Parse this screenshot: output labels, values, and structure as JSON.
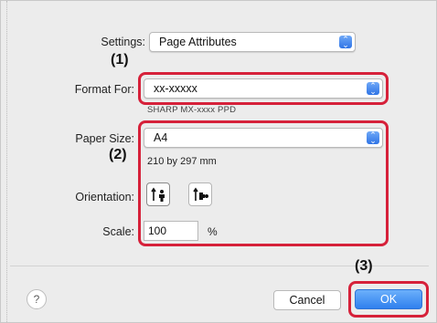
{
  "settings": {
    "label": "Settings:",
    "value": "Page Attributes"
  },
  "format_for": {
    "label": "Format For:",
    "value": "xx-xxxxx",
    "hint": "SHARP MX-xxxx PPD"
  },
  "paper_size": {
    "label": "Paper Size:",
    "value": "A4",
    "dimensions": "210 by 297 mm"
  },
  "orientation": {
    "label": "Orientation:"
  },
  "scale": {
    "label": "Scale:",
    "value": "100",
    "unit": "%"
  },
  "callouts": {
    "c1": "(1)",
    "c2": "(2)",
    "c3": "(3)"
  },
  "buttons": {
    "help": "?",
    "cancel": "Cancel",
    "ok": "OK"
  },
  "colors": {
    "highlight": "#d6213a",
    "accent": "#2f80ee"
  },
  "icons": {
    "popup": "updown-chevron-icon",
    "portrait": "portrait-orientation-icon",
    "landscape": "landscape-orientation-icon"
  }
}
